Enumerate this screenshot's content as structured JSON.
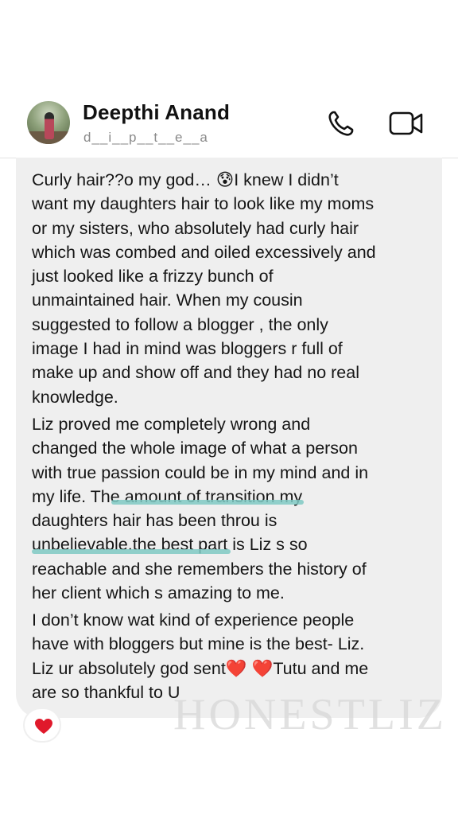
{
  "header": {
    "name": "Deepthi Anand",
    "handle": "d__i__p__t__e__a",
    "icons": [
      "phone-icon",
      "video-camera-icon"
    ]
  },
  "message": {
    "para1": [
      "Curly hair??o my god… 😰I knew I didn’t",
      "want my daughters hair to look like my moms",
      "or my sisters, who absolutely had curly hair",
      "which was combed and oiled excessively and",
      "just looked like a frizzy bunch of",
      "unmaintained hair. When my cousin",
      "suggested to follow a blogger , the only",
      "image I had in mind was bloggers r full of",
      "make up and show off and they had no real",
      "knowledge."
    ],
    "para2": [
      "Liz proved me completely wrong and",
      "changed the whole image of what a person",
      "with true passion could be in my mind and in",
      "my life. The amount of transition my",
      "daughters hair has been throu is",
      "unbelievable.the best part is Liz s so",
      "reachable and she remembers the history of",
      "her client which s amazing to me."
    ],
    "para3": [
      "I don’t know wat kind of experience people",
      "have with bloggers but mine is the best- Liz.",
      "Liz ur absolutely god sent❤️ ❤️Tutu and me",
      "are so thankful to U"
    ]
  },
  "reaction": {
    "emoji": "heart-icon",
    "color": "#e0192b"
  },
  "watermark": "HONESTLIZ",
  "colors": {
    "bubble": "#efefef",
    "highlight": "#7fc9c3",
    "handle": "#8a8a8a"
  }
}
